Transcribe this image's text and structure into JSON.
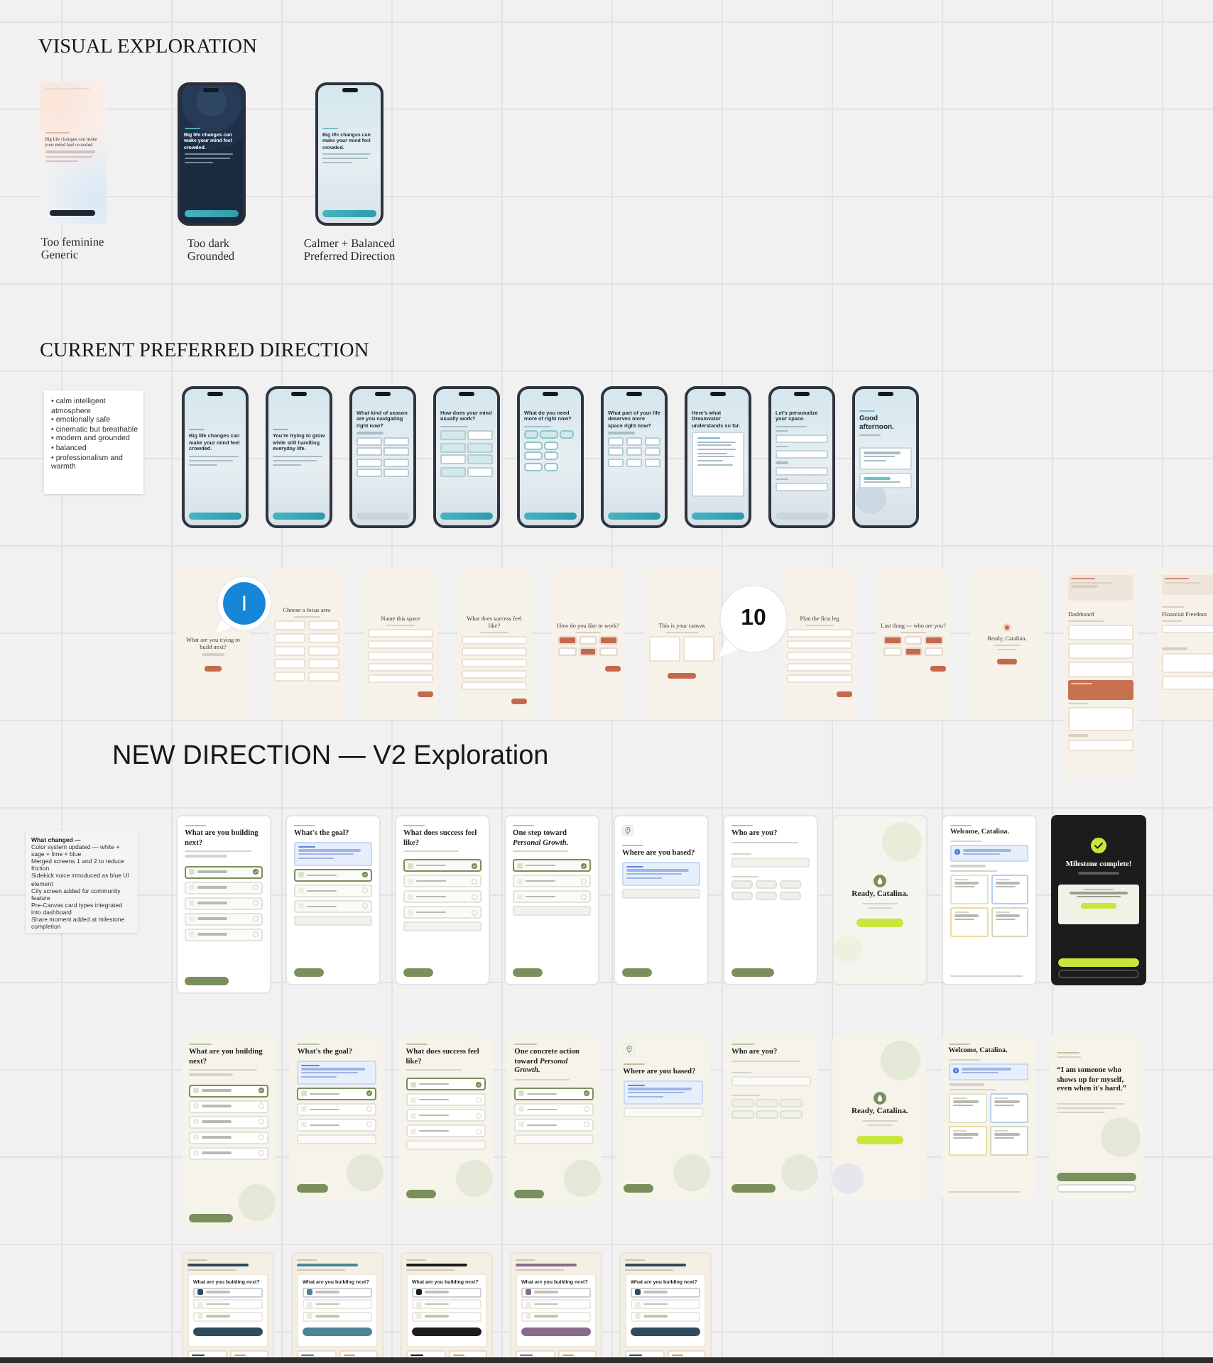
{
  "visual_exploration": {
    "heading": "VISUAL EXPLORATION",
    "mockups": [
      {
        "kind": "flat-pastel",
        "title": "Big life changes can make your mind feel crowded.",
        "caption": [
          "Too feminine",
          "Generic"
        ]
      },
      {
        "kind": "phone-dark",
        "title": "Big life changes can make your mind feel crowded.",
        "caption": [
          "Too dark",
          "Grounded"
        ]
      },
      {
        "kind": "phone-light",
        "title": "Big life changes can make your mind feel crowded.",
        "caption": [
          "Calmer + Balanced",
          "Preferred Direction"
        ]
      }
    ]
  },
  "current_direction": {
    "heading": "CURRENT PREFERRED DIRECTION",
    "note": [
      "• calm intelligent atmosphere",
      "• emotionally safe",
      "• cinematic but breathable",
      "• modern and grounded",
      "• balanced",
      "• professionalism and warmth"
    ],
    "phones": [
      {
        "kind": "hero",
        "title": "Big life changes can make your mind feel crowded."
      },
      {
        "kind": "hero",
        "title": "You're trying to grow while still handling everyday life."
      },
      {
        "kind": "grid",
        "title": "What kind of season are you navigating right now?"
      },
      {
        "kind": "grid-tinted",
        "title": "How does your mind usually work?"
      },
      {
        "kind": "chips",
        "title": "What do you need more of right now?"
      },
      {
        "kind": "tiles",
        "title": "What part of your life deserves more space right now?"
      },
      {
        "kind": "summary",
        "title": "Here's what Dreamvator understands so far."
      },
      {
        "kind": "form",
        "title": "Let's personalize your space."
      },
      {
        "kind": "greeting",
        "title": "Good afternoon."
      }
    ]
  },
  "beige_screens": [
    {
      "kind": "question",
      "title": "What are you trying to build next?"
    },
    {
      "kind": "grid",
      "title": "Choose a focus area"
    },
    {
      "kind": "fields",
      "title": "Name this space"
    },
    {
      "kind": "fields",
      "title": "What does success feel like?"
    },
    {
      "kind": "chips",
      "title": "How do you like to work?"
    },
    {
      "kind": "canvas",
      "title": "This is your canvas"
    },
    {
      "kind": "fields",
      "title": "Plan the first leg"
    },
    {
      "kind": "chips",
      "title": "Last thing — who are you?"
    },
    {
      "kind": "ready",
      "title": "Ready, Catalina."
    },
    {
      "kind": "dashboard",
      "title": "Dashboard"
    },
    {
      "kind": "detail",
      "title": "Financial Freedom"
    }
  ],
  "comments": [
    {
      "kind": "avatar",
      "label": "I"
    },
    {
      "kind": "count",
      "label": "10"
    }
  ],
  "new_direction": {
    "heading": "NEW DIRECTION — V2 Exploration",
    "note": {
      "title": "What changed —",
      "lines": [
        "Color system updated — white + sage + lime + blue",
        "Merged screens 1 and 2 to reduce friction",
        "Sidekick voice introduced as blue UI element",
        "City screen added for community feature",
        "Pre-Canvas card types integrated into dashboard",
        "Share moment added at milestone completion"
      ]
    },
    "row_1": [
      {
        "kind": "choices",
        "title": "What are you building next?",
        "options": [
          {
            "selected": true
          },
          {
            "selected": false
          },
          {
            "selected": false
          },
          {
            "selected": false
          },
          {
            "selected": false
          }
        ]
      },
      {
        "kind": "quote-options",
        "title": "What's the goal?",
        "options": [
          {
            "selected": true
          },
          {
            "selected": false
          },
          {
            "selected": false
          }
        ]
      },
      {
        "kind": "options",
        "title": "What does success feel like?",
        "options": [
          {
            "selected": true
          },
          {
            "selected": false
          },
          {
            "selected": false
          },
          {
            "selected": false
          }
        ]
      },
      {
        "kind": "options",
        "title": "One step toward *Personal Growth.*",
        "options": [
          {
            "selected": true
          },
          {
            "selected": false
          },
          {
            "selected": false
          }
        ]
      },
      {
        "kind": "location",
        "title": "Where are you based?"
      },
      {
        "kind": "identity",
        "title": "Who are you?"
      },
      {
        "kind": "ready",
        "title": "Ready, Catalina."
      },
      {
        "kind": "dashboard",
        "title": "Welcome, Catalina."
      },
      {
        "kind": "milestone",
        "title": "Milestone complete!"
      }
    ],
    "row_2": [
      {
        "kind": "choices",
        "title": "What are you building next?",
        "options": [
          {
            "selected": true
          },
          {
            "selected": false
          },
          {
            "selected": false
          },
          {
            "selected": false
          },
          {
            "selected": false
          }
        ]
      },
      {
        "kind": "quote-options",
        "title": "What's the goal?",
        "options": [
          {
            "selected": true
          },
          {
            "selected": false
          },
          {
            "selected": false
          }
        ]
      },
      {
        "kind": "options",
        "title": "What does success feel like?",
        "options": [
          {
            "selected": true
          },
          {
            "selected": false
          },
          {
            "selected": false
          },
          {
            "selected": false
          }
        ]
      },
      {
        "kind": "options",
        "title": "One concrete action toward *Personal Growth.*",
        "options": [
          {
            "selected": true
          },
          {
            "selected": false
          },
          {
            "selected": false
          }
        ]
      },
      {
        "kind": "location",
        "title": "Where are you based?"
      },
      {
        "kind": "identity",
        "title": "Who are you?"
      },
      {
        "kind": "ready",
        "title": "Ready, Catalina."
      },
      {
        "kind": "dashboard",
        "title": "Welcome, Catalina."
      },
      {
        "kind": "quote",
        "title": "“I am someone who shows up for myself, even when it's hard.”"
      }
    ],
    "row_3": [
      {
        "title": "What are you building next?",
        "color": "#2e4a5b"
      },
      {
        "title": "What are you building next?",
        "color": "#4b8494"
      },
      {
        "title": "What are you building next?",
        "color": "#1c1c1a"
      },
      {
        "title": "What are you building next?",
        "color": "#8a6b8c"
      },
      {
        "title": "What are you building next?",
        "color": "#2f4b5c"
      }
    ]
  }
}
